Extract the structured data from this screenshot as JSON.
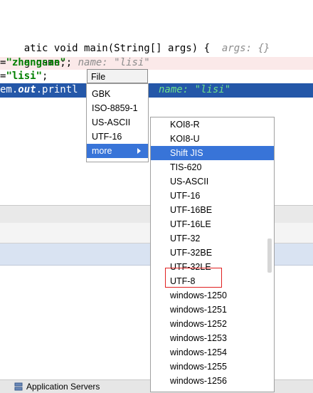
{
  "editor": {
    "lines": [
      {
        "code": "atic void main(String[] args) {",
        "hint": "args: {}"
      },
      {
        "code": "g name;",
        "hint": "name: \"lisi\""
      },
      {
        "prefix": "=",
        "string": "\"zhangsan\"",
        "suffix": ";"
      },
      {
        "prefix": "=",
        "string": "\"lisi\"",
        "suffix": ";"
      },
      {
        "pre": "em.",
        "italic": "out",
        "post": ".printl",
        "hint": "name: \"lisi\""
      }
    ]
  },
  "encoding_popup": {
    "title": "File Encoding",
    "items": [
      "GBK",
      "ISO-8859-1",
      "US-ASCII",
      "UTF-16",
      "more"
    ],
    "active_item": "more"
  },
  "submenu": {
    "items": [
      "KOI8-R",
      "KOI8-U",
      "Shift JIS",
      "TIS-620",
      "US-ASCII",
      "UTF-16",
      "UTF-16BE",
      "UTF-16LE",
      "UTF-32",
      "UTF-32BE",
      "UTF-32LE",
      "UTF-8",
      "windows-1250",
      "windows-1251",
      "windows-1252",
      "windows-1253",
      "windows-1254",
      "windows-1255",
      "windows-1256"
    ],
    "active_item": "Shift JIS",
    "highlighted_item": "UTF-8"
  },
  "statusbar": {
    "app_servers_label": "Application Servers"
  },
  "colors": {
    "selection": "#2457a8",
    "menu_active": "#3874d8",
    "highlight_box": "#e02020"
  }
}
